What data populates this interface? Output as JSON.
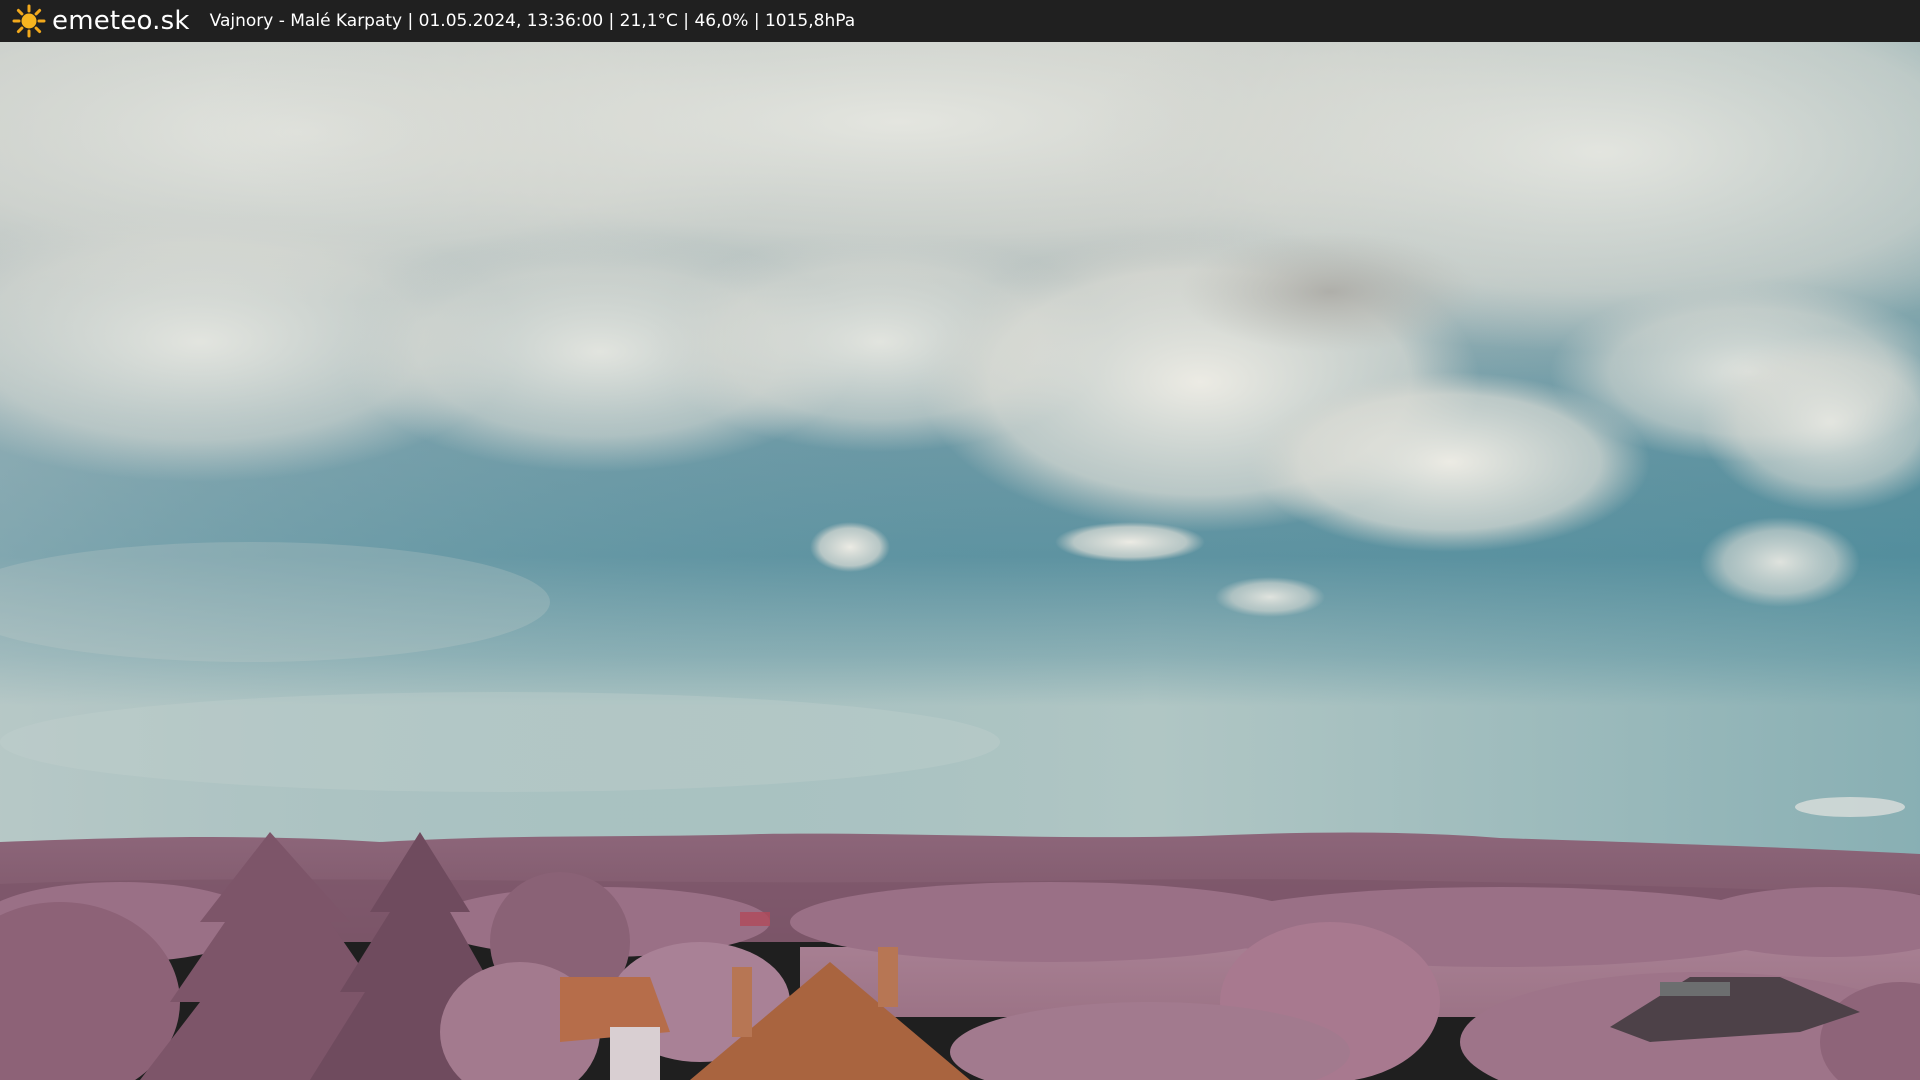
{
  "header": {
    "brand": "emeteo.sk",
    "logo_icon": "sun-icon",
    "caption": "Vajnory - Malé Karpaty | 01.05.2024, 13:36:00 | 21,1°C | 46,0% | 1015,8hPa"
  },
  "colors": {
    "bar_background": "#202020",
    "sun": "#f2a91c",
    "sky_top": "#c9cdc7",
    "sky_mid": "#5f94a2",
    "sky_horizon": "#a9c3c2",
    "hills": "#8a5e73",
    "foliage": "#b0849a",
    "roof": "#b06a47"
  }
}
